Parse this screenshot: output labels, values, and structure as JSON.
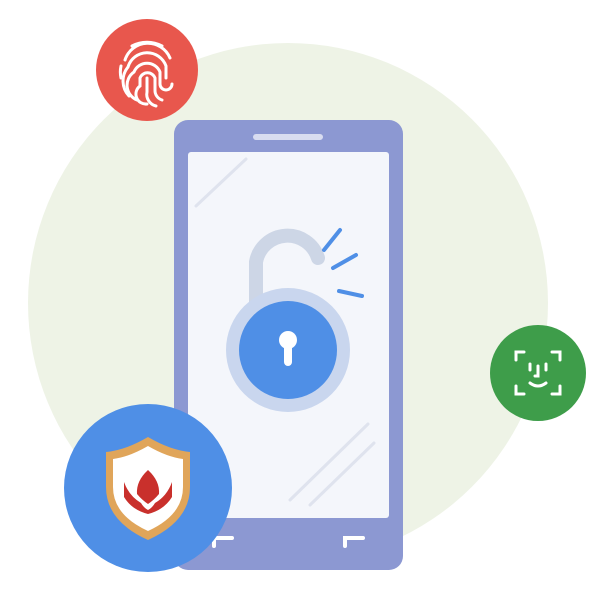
{
  "illustration": {
    "subject": "phone-unlock-security",
    "icons": [
      "fingerprint-icon",
      "face-id-icon",
      "shield-icon",
      "padlock-open-icon"
    ],
    "colors": {
      "backdrop": "#eef3e6",
      "phone_body": "#8c98d2",
      "phone_screen": "#f4f6fb",
      "lock_ring": "#c9d6ee",
      "lock_face": "#4f8fe6",
      "lock_shackle": "#cdd6e6",
      "fingerprint_badge": "#e8574d",
      "face_id_badge": "#3e9d4a",
      "shield_badge": "#4f8fe6",
      "shield_fill": "#ffffff",
      "shield_border": "#e0a55a",
      "shield_emblem": "#c9302c",
      "spark_lines": "#4f8fe6"
    }
  }
}
